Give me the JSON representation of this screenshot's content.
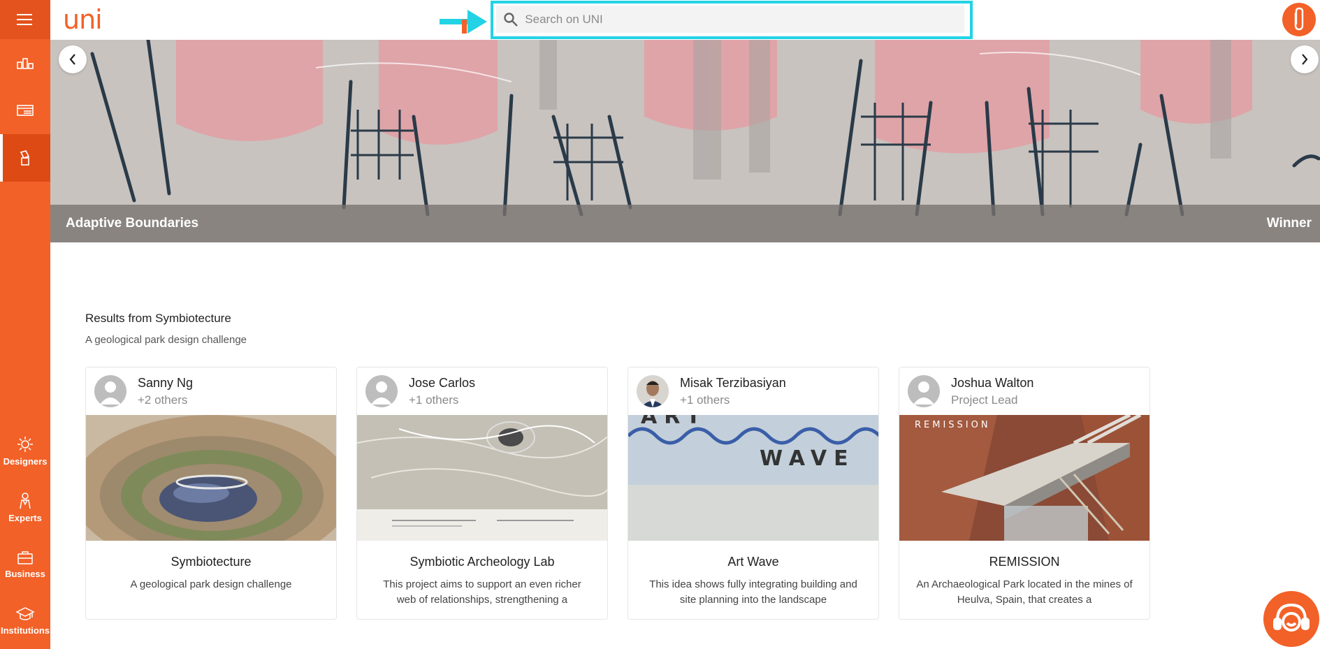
{
  "app": {
    "logo_text": "uni",
    "brand_color": "#f26128",
    "annotation_color": "#22d3e6"
  },
  "sidebar": {
    "menu_icon": "hamburger-icon",
    "top_icons": [
      "competitions-icon",
      "projects-list-icon",
      "submissions-icon"
    ],
    "categories": [
      {
        "label": "Designers",
        "icon": "sun-gear-icon"
      },
      {
        "label": "Experts",
        "icon": "person-icon"
      },
      {
        "label": "Business",
        "icon": "briefcase-icon"
      },
      {
        "label": "Institutions",
        "icon": "graduation-cap-icon"
      }
    ]
  },
  "search": {
    "placeholder": "Search on UNI"
  },
  "hero": {
    "title": "Adaptive Boundaries",
    "badge": "Winner"
  },
  "results": {
    "title": "Results from Symbiotecture",
    "subtitle": "A geological park design challenge"
  },
  "cards": [
    {
      "author": "Sanny Ng",
      "others": "+2 others",
      "title": "Symbiotecture",
      "desc": "A geological park design challenge"
    },
    {
      "author": "Jose Carlos",
      "others": "+1 others",
      "title": "Symbiotic Archeology Lab",
      "desc": "This project aims to support an even richer web of relationships, strengthening a"
    },
    {
      "author": "Misak Terzibasiyan",
      "others": "+1 others",
      "title": "Art Wave",
      "desc": "This idea shows fully integrating building and site planning into the landscape",
      "img_text_1": "ART",
      "img_text_2": "WAVE"
    },
    {
      "author": "Joshua Walton",
      "others": "Project Lead",
      "title": "REMISSION",
      "desc": "An Archaeological Park located in the mines of Heulva, Spain, that creates a",
      "img_text_1": "REMISSION"
    }
  ]
}
